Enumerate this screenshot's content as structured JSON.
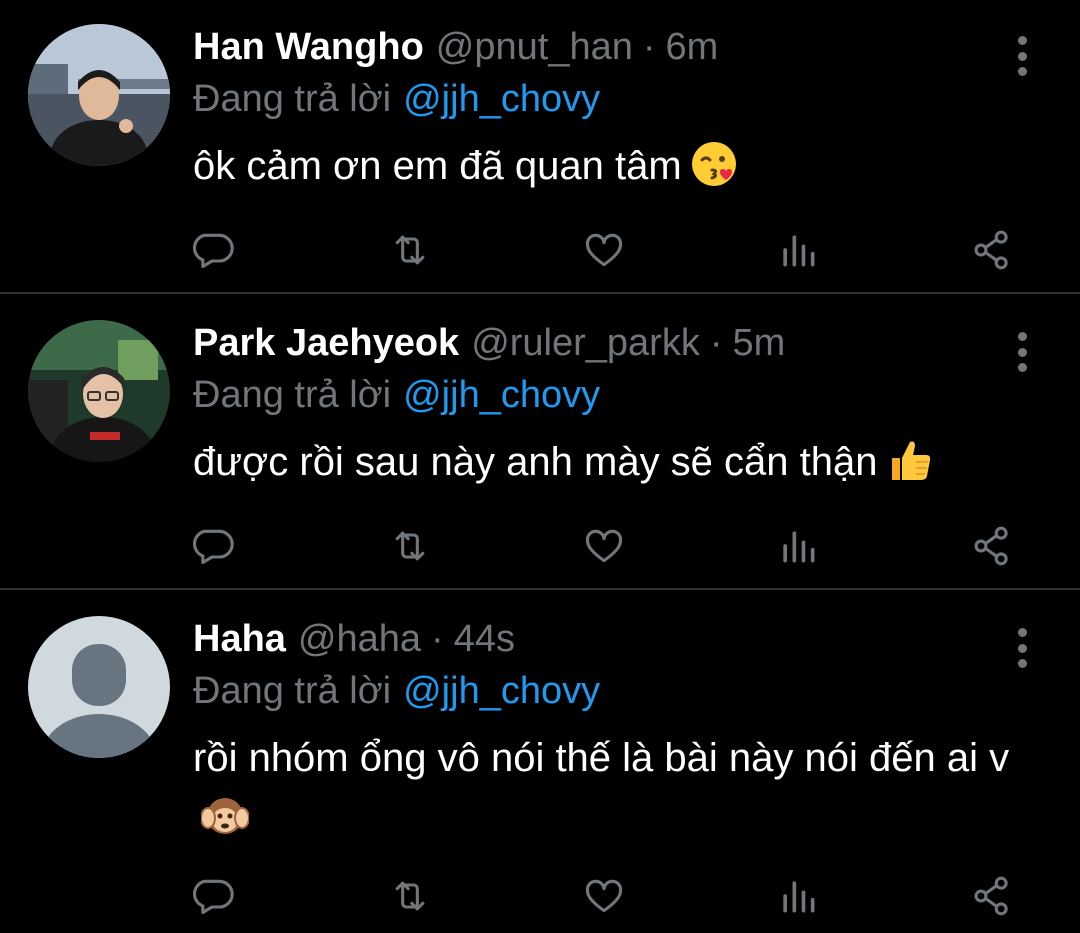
{
  "tweets": [
    {
      "display_name": "Han Wangho",
      "handle": "@pnut_han",
      "separator": "·",
      "time": "6m",
      "replying_label": "Đang trả lời",
      "replying_to": "@jjh_chovy",
      "text": "ôk cảm ơn em đã quan tâm",
      "emoji": "kissing-wink-emoji"
    },
    {
      "display_name": "Park Jaehyeok",
      "handle": "@ruler_parkk",
      "separator": "·",
      "time": "5m",
      "replying_label": "Đang trả lời",
      "replying_to": "@jjh_chovy",
      "text": "được rồi sau này anh mày sẽ cẩn thận",
      "emoji": "thumbs-up-emoji"
    },
    {
      "display_name": "Haha",
      "handle": "@haha",
      "separator": "·",
      "time": "44s",
      "replying_label": "Đang trả lời",
      "replying_to": "@jjh_chovy",
      "text": "rồi nhóm ổng vô nói thế là bài này nói đến ai v",
      "emoji": "hear-no-evil-monkey-emoji"
    }
  ],
  "action_icons": [
    "reply-icon",
    "retweet-icon",
    "like-icon",
    "analytics-icon",
    "share-icon"
  ],
  "colors": {
    "background": "#000000",
    "divider": "#2f3336",
    "muted": "#71767b",
    "link": "#1d9bf0",
    "text": "#ffffff"
  }
}
